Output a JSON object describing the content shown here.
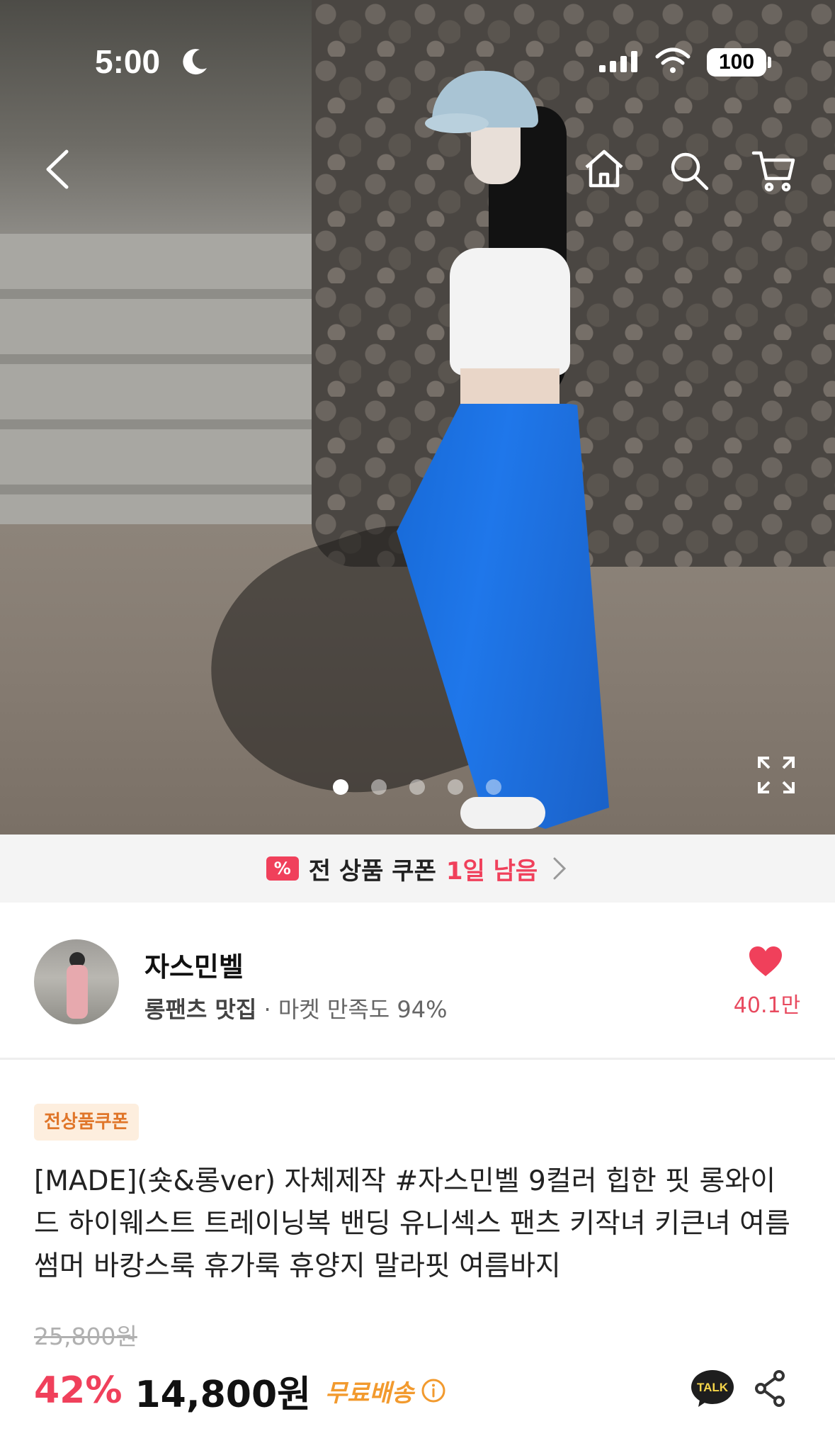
{
  "status_bar": {
    "time": "5:00",
    "battery": "100"
  },
  "nav": {
    "back_icon": "chevron-left-icon",
    "home_icon": "home-icon",
    "search_icon": "search-icon",
    "cart_icon": "cart-icon"
  },
  "carousel": {
    "total": 5,
    "active_index": 0
  },
  "coupon_banner": {
    "badge_symbol": "%",
    "text": "전 상품 쿠폰",
    "remaining": "1일 남음"
  },
  "seller": {
    "name": "자스민벨",
    "category": "롱팬츠 맛집",
    "satisfaction": "· 마켓 만족도 94%",
    "likes": "40.1만"
  },
  "product": {
    "badge": "전상품쿠폰",
    "title": "[MADE](숏&롱ver) 자체제작 #자스민벨 9컬러 힙한 핏 롱와이드 하이웨스트 트레이닝복 밴딩 유니섹스 팬츠 키작녀 키큰녀 여름 썸머 바캉스룩 휴가룩 휴양지 말라핏 여름바지",
    "original_price": "25,800원",
    "discount": "42%",
    "price": "14,800원",
    "shipping": "무료배송"
  },
  "actions": {
    "talk_label": "TALK"
  },
  "colors": {
    "accent": "#f0405b",
    "shipping": "#f29a2e",
    "pants": "#1f77ea"
  }
}
